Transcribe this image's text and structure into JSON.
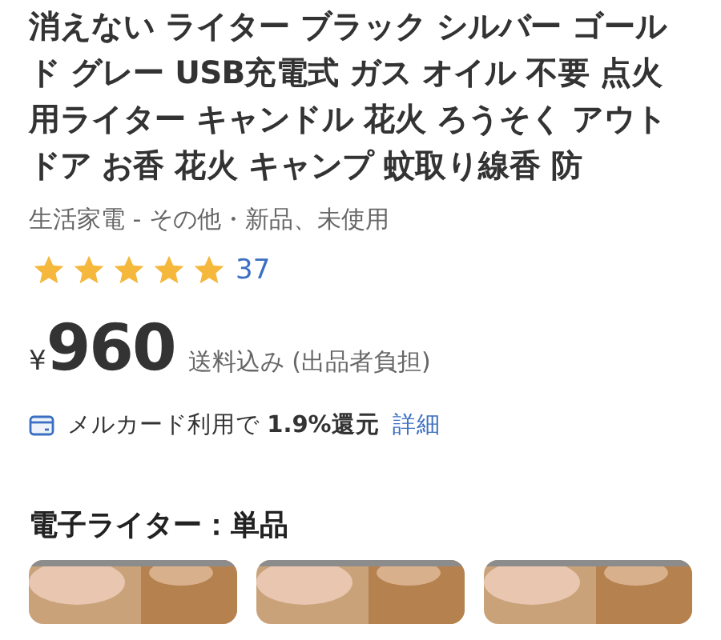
{
  "title": "消えない ライター ブラック シルバー ゴールド グレー USB充電式 ガス オイル 不要 点火用ライター キャンドル 花火 ろうそく アウトドア お香 花火 キャンプ 蚊取り線香 防",
  "category": "生活家電 - その他・新品、未使用",
  "rating": {
    "stars": 5,
    "count": "37"
  },
  "price": {
    "currency": "¥",
    "amount": "960",
    "shipping": "送料込み (出品者負担)"
  },
  "card_offer": {
    "text": "メルカード利用で **1.9%還元**",
    "link": "詳細"
  },
  "section_title": "電子ライター：単品"
}
